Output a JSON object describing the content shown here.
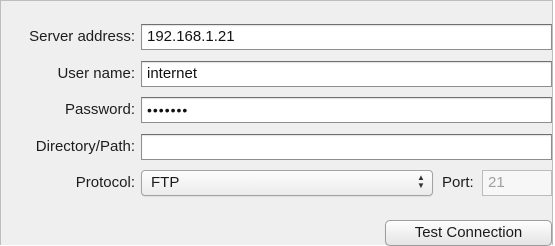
{
  "form": {
    "server_address": {
      "label": "Server address:",
      "value": "192.168.1.21"
    },
    "user_name": {
      "label": "User name:",
      "value": "internet"
    },
    "password": {
      "label": "Password:",
      "value": "•••••••"
    },
    "directory_path": {
      "label": "Directory/Path:",
      "value": ""
    },
    "protocol": {
      "label": "Protocol:",
      "selected": "FTP"
    },
    "port": {
      "label": "Port:",
      "placeholder": "21"
    }
  },
  "actions": {
    "test_connection_label": "Test Connection"
  }
}
